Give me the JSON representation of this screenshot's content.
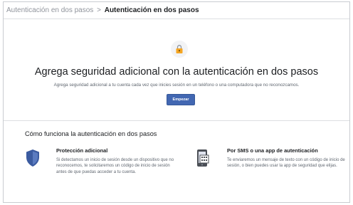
{
  "breadcrumb": {
    "parent": "Autenticación en dos pasos",
    "separator": ">",
    "current": "Autenticación en dos pasos"
  },
  "hero": {
    "icon": "lock-key-icon",
    "title": "Agrega seguridad adicional con la autenticación en dos pasos",
    "subtitle": "Agrega seguridad adicional a tu cuenta cada vez que inicies sesión en un teléfono o una computadora que no reconozcamos.",
    "button_label": "Empezar"
  },
  "how_it_works": {
    "title": "Cómo funciona la autenticación en dos pasos",
    "features": [
      {
        "icon": "shield-icon",
        "title": "Protección adicional",
        "description": "Si detectamos un inicio de sesión desde un dispositivo que no reconocemos, te solicitaremos un código de inicio de sesión antes de que puedas acceder a tu cuenta."
      },
      {
        "icon": "phone-code-icon",
        "title": "Por SMS o una app de autenticación",
        "description": "Te enviaremos un mensaje de texto con un código de inicio de sesión, o bien puedes usar la app de seguridad que elijas."
      }
    ]
  },
  "colors": {
    "accent": "#4267b2",
    "shield": "#3b5ba0",
    "lock": "#f5a623"
  }
}
